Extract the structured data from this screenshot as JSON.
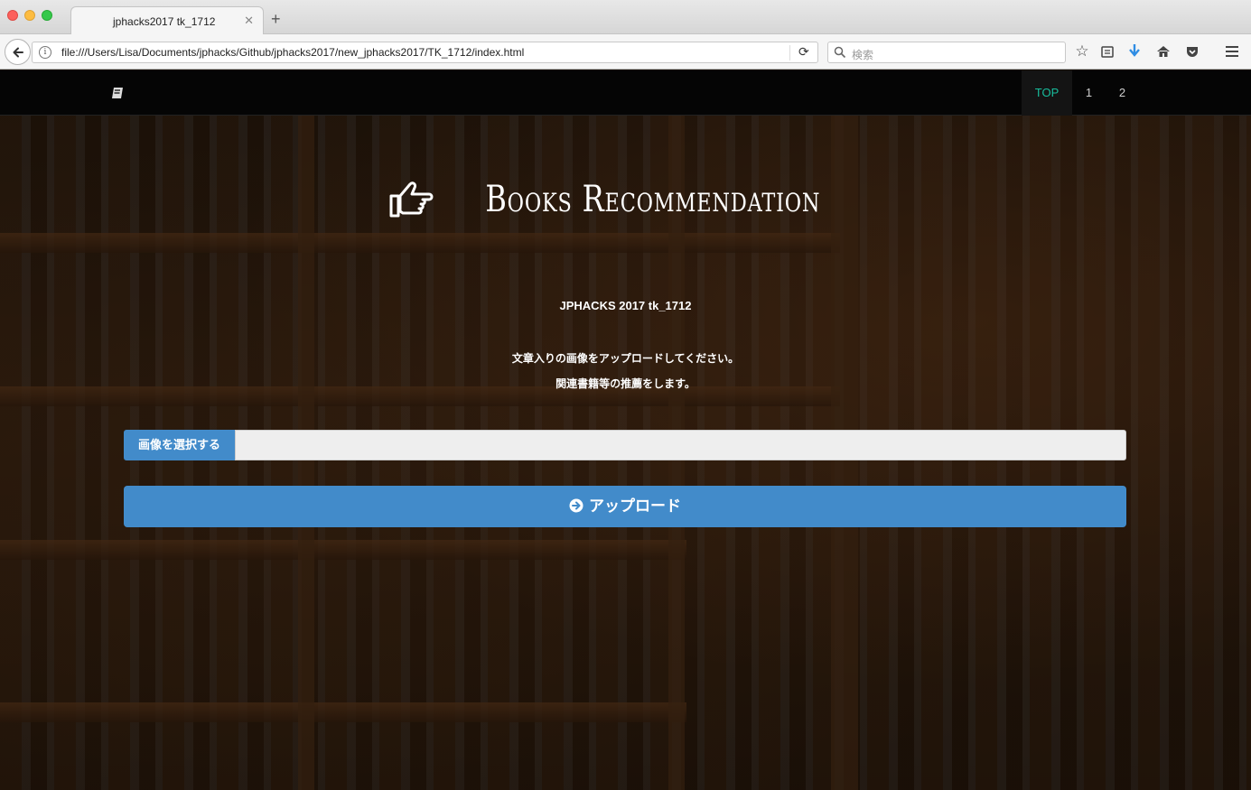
{
  "browser": {
    "tab_title": "jphacks2017 tk_1712",
    "tab_close": "✕",
    "new_tab": "+",
    "url": "file:///Users/Lisa/Documents/jphacks/Github/jphacks2017/new_jphacks2017/TK_1712/index.html",
    "search_placeholder": "検索"
  },
  "nav": {
    "brand_icon": "book-icon",
    "items": [
      {
        "label": "TOP",
        "active": true
      },
      {
        "label": "1",
        "active": false
      },
      {
        "label": "2",
        "active": false
      }
    ]
  },
  "hero": {
    "title": "Books Recommendation",
    "title_icon": "hand-pointing-right-icon",
    "subtitle": "JPHACKS 2017 tk_1712",
    "description_line1": "文章入りの画像をアップロードしてください。",
    "description_line2": "関連書籍等の推薦をします。"
  },
  "form": {
    "file_button_label": "画像を選択する",
    "file_value": "",
    "upload_button_label": "アップロード",
    "upload_icon": "arrow-circle-right-icon"
  },
  "colors": {
    "accent": "#428bca",
    "nav_active": "#18bc9c",
    "nav_bg": "#050505"
  }
}
